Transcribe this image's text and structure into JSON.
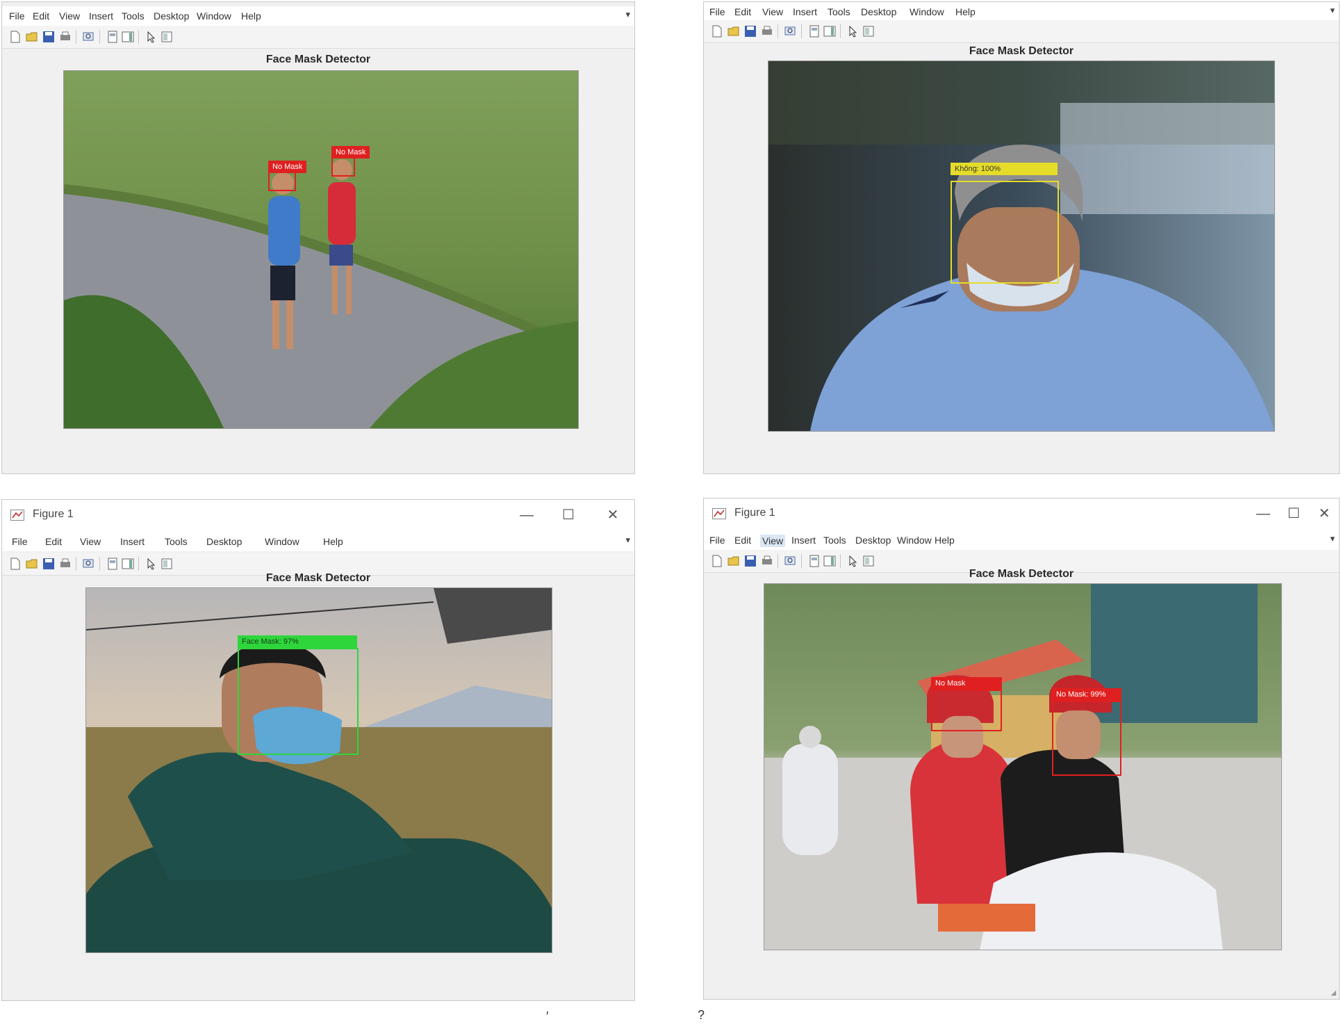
{
  "menu": [
    "File",
    "Edit",
    "View",
    "Insert",
    "Tools",
    "Desktop",
    "Window",
    "Help"
  ],
  "figure_title": "Face Mask Detector",
  "window_title": "Figure 1",
  "window_controls": {
    "minimize": "—",
    "maximize": "☐",
    "close": "✕"
  },
  "menu_arrow": "▾",
  "toolbar_icons": [
    "new-figure-icon",
    "open-file-icon",
    "save-icon",
    "print-icon",
    "zoom-icon",
    "link-plot-icon",
    "insert-colorbar-icon",
    "pointer-icon",
    "plot-tools-icon"
  ],
  "panels": {
    "top_left": {
      "detections": [
        {
          "label": "No Mask",
          "color": "#e02020"
        },
        {
          "label": "No Mask",
          "color": "#e02020"
        }
      ]
    },
    "top_right": {
      "detections": [
        {
          "label": "Không: 100%",
          "color": "#e6dc2a"
        }
      ]
    },
    "bottom_left": {
      "detections": [
        {
          "label": "Face Mask: 97%",
          "color": "#2ed63c"
        }
      ]
    },
    "bottom_right": {
      "detections": [
        {
          "label": "No Mask",
          "color": "#e02020"
        },
        {
          "label": "No Mask: 99%",
          "color": "#e02020"
        }
      ]
    }
  },
  "stray_marks": [
    "′",
    "?"
  ]
}
